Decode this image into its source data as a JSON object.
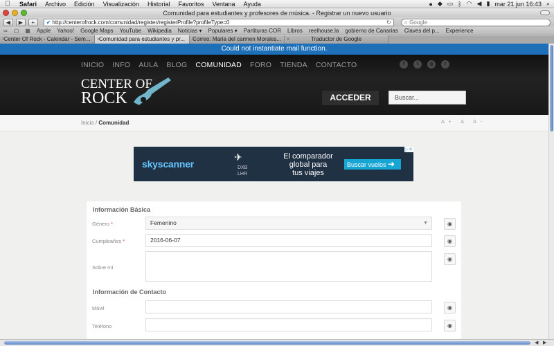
{
  "os_menu": {
    "apple": "",
    "items": [
      "Safari",
      "Archivo",
      "Edición",
      "Visualización",
      "Historial",
      "Favoritos",
      "Ventana",
      "Ayuda"
    ],
    "clock": "mar 21 jun  16:43"
  },
  "window": {
    "title": "Comunidad para estudiantes y profesores de música. - Registrar un nuevo usuario"
  },
  "toolbar": {
    "url": "http://centerofrock.com/comunidad/register/registerProfile?profileType=0",
    "search_placeholder": "Google"
  },
  "bookmarks": [
    "Apple",
    "Yahoo!",
    "Google Maps",
    "YouTube",
    "Wikipedia",
    "Noticias ▾",
    "Populares ▾",
    "Partituras COR",
    "Libros",
    "reelhouse.la",
    "gobierno de Canarias",
    "Claves del p...",
    "Experience"
  ],
  "tabs": [
    {
      "label": "Center Of Rock - Calendar - Sem..."
    },
    {
      "label": "Comunidad para estudiantes y pr..."
    },
    {
      "label": "Correo: Maria del carmen Morales..."
    },
    {
      "label": "Traductor de Google"
    }
  ],
  "notice": "Could not instantiate mail function.",
  "site": {
    "nav": [
      "INICIO",
      "INFO",
      "AULA",
      "BLOG",
      "COMUNIDAD",
      "FORO",
      "TIENDA",
      "CONTACTO"
    ],
    "nav_active": "COMUNIDAD",
    "logo_line1": "CENTER OF",
    "logo_line2": "ROCK",
    "login_label": "ACCEDER",
    "search_placeholder": "Buscar..."
  },
  "breadcrumb": {
    "home": "Inicio",
    "sep": "/",
    "current": "Comunidad",
    "font_controls": "A+ A A-"
  },
  "ad": {
    "brand": "skyscanner",
    "route_from": "DXB",
    "route_to": "LHR",
    "line1": "El comparador",
    "line2": "global para",
    "line3": "tus viajes",
    "cta": "Buscar vuelos"
  },
  "form": {
    "section_basic": "Información Básica",
    "gender_label": "Género",
    "gender_value": "Femenino",
    "birthday_label": "Cumpleaños",
    "birthday_value": "2016-06-07",
    "about_label": "Sobre mí",
    "section_contact": "Información de Contacto",
    "mobile_label": "Móvil",
    "phone_label": "Teléfono"
  },
  "colors": {
    "notice_bg": "#1d6fb8",
    "header_bg": "#1a1a1a",
    "required": "#e04d3a",
    "ad_bg": "#1f3143",
    "ad_cta": "#17a5d4"
  }
}
